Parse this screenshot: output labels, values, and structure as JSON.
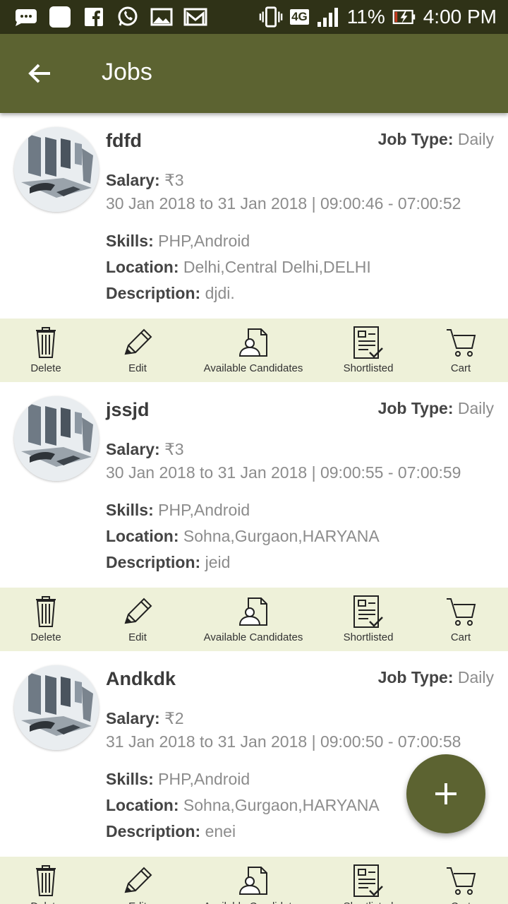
{
  "status_bar": {
    "network": "4G",
    "battery": "11%",
    "time": "4:00 PM",
    "icons": [
      "messages-icon",
      "app-icon",
      "facebook-icon",
      "whatsapp-icon",
      "gallery-icon",
      "gmail-icon",
      "vibrate-icon",
      "signal-icon",
      "battery-charging-icon"
    ]
  },
  "app_bar": {
    "title": "Jobs",
    "back_icon": "arrow-back-icon"
  },
  "labels": {
    "job_type": "Job Type:",
    "salary": "Salary:",
    "skills": "Skills:",
    "location": "Location:",
    "description": "Description:"
  },
  "actions": [
    {
      "label": "Delete",
      "icon": "trash-icon"
    },
    {
      "label": "Edit",
      "icon": "pencil-icon"
    },
    {
      "label": "Available Candidates",
      "icon": "candidate-document-icon"
    },
    {
      "label": "Shortlisted",
      "icon": "checklist-icon"
    },
    {
      "label": "Cart",
      "icon": "cart-icon"
    }
  ],
  "jobs": [
    {
      "name": "fdfd",
      "job_type": "Daily",
      "salary": "₹3",
      "dates": "30 Jan 2018 to 31 Jan 2018 | 09:00:46 - 07:00:52",
      "skills": "PHP,Android",
      "location": "Delhi,Central Delhi,DELHI",
      "description": "djdi."
    },
    {
      "name": "jssjd",
      "job_type": "Daily",
      "salary": "₹3",
      "dates": "30 Jan 2018 to 31 Jan 2018 | 09:00:55 - 07:00:59",
      "skills": "PHP,Android",
      "location": "Sohna,Gurgaon,HARYANA",
      "description": "jeid"
    },
    {
      "name": "Andkdk",
      "job_type": "Daily",
      "salary": "₹2",
      "dates": "31 Jan 2018 to 31 Jan 2018 | 09:00:50 - 07:00:58",
      "skills": "PHP,Android",
      "location": "Sohna,Gurgaon,HARYANA",
      "description": "enei"
    }
  ],
  "fab": {
    "icon": "plus-icon"
  },
  "colors": {
    "primary": "#5c6331",
    "status_bar": "#2f3217",
    "action_bar": "#eef1d9",
    "label": "#444444",
    "value": "#8c8c8c"
  }
}
